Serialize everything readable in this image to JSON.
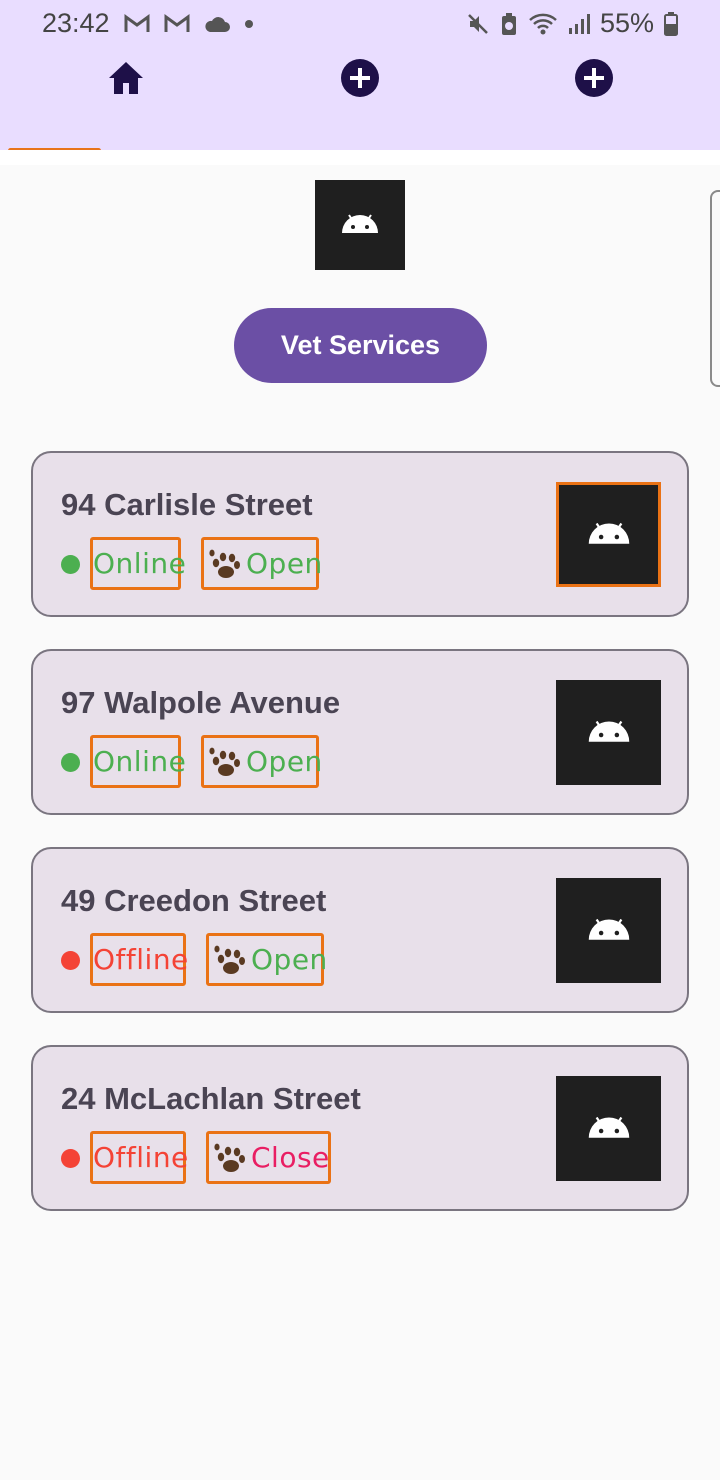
{
  "status_bar": {
    "time": "23:42",
    "battery": "55%"
  },
  "tabs": [
    {
      "name": "home",
      "icon": "home-icon"
    },
    {
      "name": "add",
      "icon": "plus-circle-icon"
    },
    {
      "name": "add",
      "icon": "plus-circle-icon"
    }
  ],
  "header": {
    "logo_icon": "android-icon",
    "vet_button_label": "Vet Services"
  },
  "colors": {
    "accent": "#e8741a",
    "online": "#4caf50",
    "offline": "#f44336",
    "open": "#4caf50",
    "close": "#e91e63",
    "button": "#6b4fa5"
  },
  "clinics": [
    {
      "address": "94 Carlisle Street",
      "connection": "Online",
      "hours": "Open"
    },
    {
      "address": "97 Walpole Avenue",
      "connection": "Online",
      "hours": "Open"
    },
    {
      "address": "49 Creedon Street",
      "connection": "Offline",
      "hours": "Open"
    },
    {
      "address": "24 McLachlan Street",
      "connection": "Offline",
      "hours": "Close"
    }
  ]
}
